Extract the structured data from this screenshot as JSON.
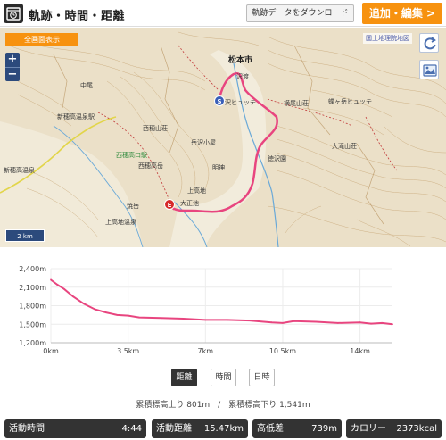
{
  "header": {
    "title": "軌跡・時間・距離",
    "download_label": "軌跡データをダウンロード",
    "add_edit_label": "追加・編集 >"
  },
  "map": {
    "fullscreen_label": "全画面表示",
    "attribution": "国土地理院地図",
    "zoom_in": "+",
    "zoom_out": "−",
    "scale": "2 km",
    "start_marker": "S",
    "end_marker": "E",
    "labels": {
      "city": "松本市",
      "sawando": "沢渡",
      "hutte": "沢ヒュッテ",
      "hutte2": "蝶ヶ岳ヒュッテ",
      "lodge": "横尾山荘",
      "shinhotaka": "新穂高温泉駅",
      "nishiho": "西穂山荘",
      "nishiho_station": "西穂高口駅",
      "kamikochi": "上高地",
      "tokusawa": "徳沢園",
      "myojin": "明神",
      "nishiho_peak": "西穂高岳",
      "okuho": "岳沢小屋",
      "taisho": "大正池",
      "ootaki": "大滝山荘",
      "nakao": "中尾",
      "kamikochi_onsen": "上高地温泉",
      "yake": "焼岳",
      "shinhodaka_onsen": "新穂高温泉"
    }
  },
  "chart_data": {
    "type": "area",
    "xlabel": "",
    "ylabel": "",
    "x_ticks": [
      "0km",
      "3.5km",
      "7km",
      "10.5km",
      "14km"
    ],
    "y_ticks": [
      "2,400m",
      "2,100m",
      "1,800m",
      "1,500m",
      "1,200m"
    ],
    "xlim": [
      0,
      15.47
    ],
    "ylim": [
      1200,
      2400
    ],
    "x": [
      0,
      0.3,
      0.6,
      1.0,
      1.5,
      2.0,
      2.5,
      3.0,
      3.5,
      4.0,
      5.0,
      6.0,
      7.0,
      8.0,
      9.0,
      10.0,
      10.5,
      11.0,
      12.0,
      13.0,
      14.0,
      14.5,
      15.0,
      15.47
    ],
    "series": [
      {
        "values": [
          2220,
          2140,
          2070,
          1950,
          1830,
          1740,
          1690,
          1650,
          1640,
          1610,
          1600,
          1590,
          1570,
          1570,
          1560,
          1530,
          1520,
          1550,
          1540,
          1520,
          1530,
          1510,
          1520,
          1500
        ]
      }
    ],
    "color": "#e8457f"
  },
  "toggle": {
    "distance": "距離",
    "time": "時間",
    "date": "日時"
  },
  "summary": "累積標高上り 801m　/　累積標高下り 1,541m",
  "stats": {
    "time_label": "活動時間",
    "time_value": "4:44",
    "distance_label": "活動距離",
    "distance_value": "15.47km",
    "elev_label": "高低差",
    "elev_value": "739m",
    "calorie_label": "カロリー",
    "calorie_value": "2373kcal"
  }
}
